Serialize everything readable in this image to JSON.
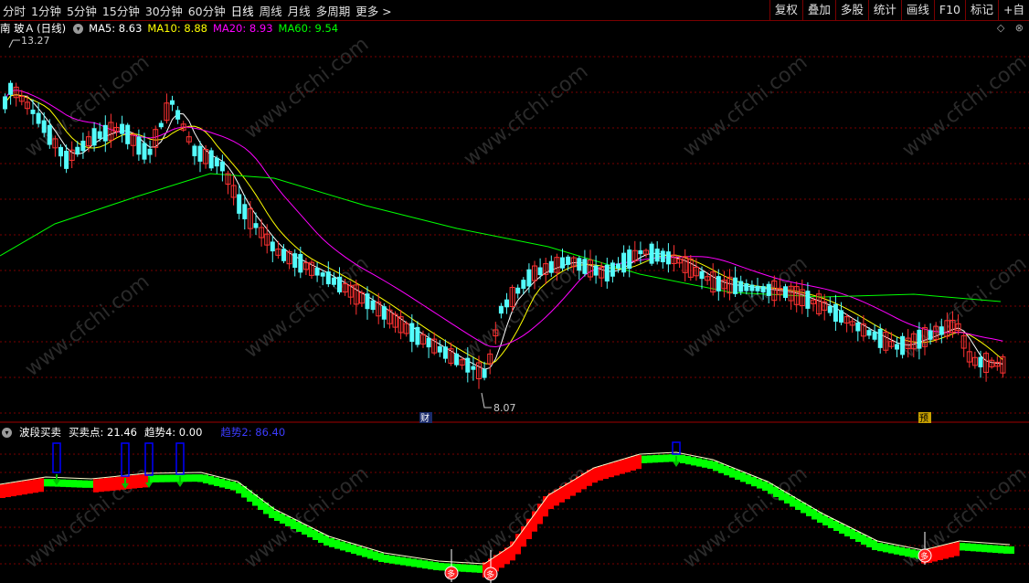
{
  "toolbar": {
    "periods": [
      "分时",
      "1分钟",
      "5分钟",
      "15分钟",
      "30分钟",
      "60分钟",
      "日线",
      "周线",
      "月线",
      "多周期",
      "更多 >"
    ],
    "active_period": "日线",
    "right_buttons": [
      "复权",
      "叠加",
      "多股",
      "统计",
      "画线",
      "F10",
      "标记",
      "+自"
    ]
  },
  "main": {
    "stock_name": "南 玻Ａ",
    "period_tag": "(日线)",
    "ma": [
      {
        "label": "MA5: 8.63",
        "color": "#ffffff"
      },
      {
        "label": "MA10: 8.88",
        "color": "#ffff00"
      },
      {
        "label": "MA20: 8.93",
        "color": "#ff00ff"
      },
      {
        "label": "MA60: 9.54",
        "color": "#00ff00"
      }
    ],
    "high_label": "13.27",
    "low_label": "8.07",
    "marker_cai": "财",
    "marker_yu": "预",
    "icons": [
      "diamond-icon",
      "close-icon"
    ],
    "colors": {
      "up": "#ff3232",
      "down": "#54fcfc",
      "ma5": "#ffffff",
      "ma10": "#ffff00",
      "ma20": "#ff00ff",
      "ma60": "#00ff00",
      "grid": "#7a0000"
    }
  },
  "indicator": {
    "name": "波段买卖",
    "buy_sell_point": "买卖点: 21.46",
    "trend4": "趋势4: 0.00",
    "trend2": "趋势2: 86.40",
    "watermark": "www.cfchi.com",
    "buy_marker": "多",
    "colors": {
      "rise": "#ff0000",
      "fall": "#00ff00",
      "line": "#ffffcc",
      "signal": "#0000ff",
      "arrow": "#00c000"
    }
  }
}
